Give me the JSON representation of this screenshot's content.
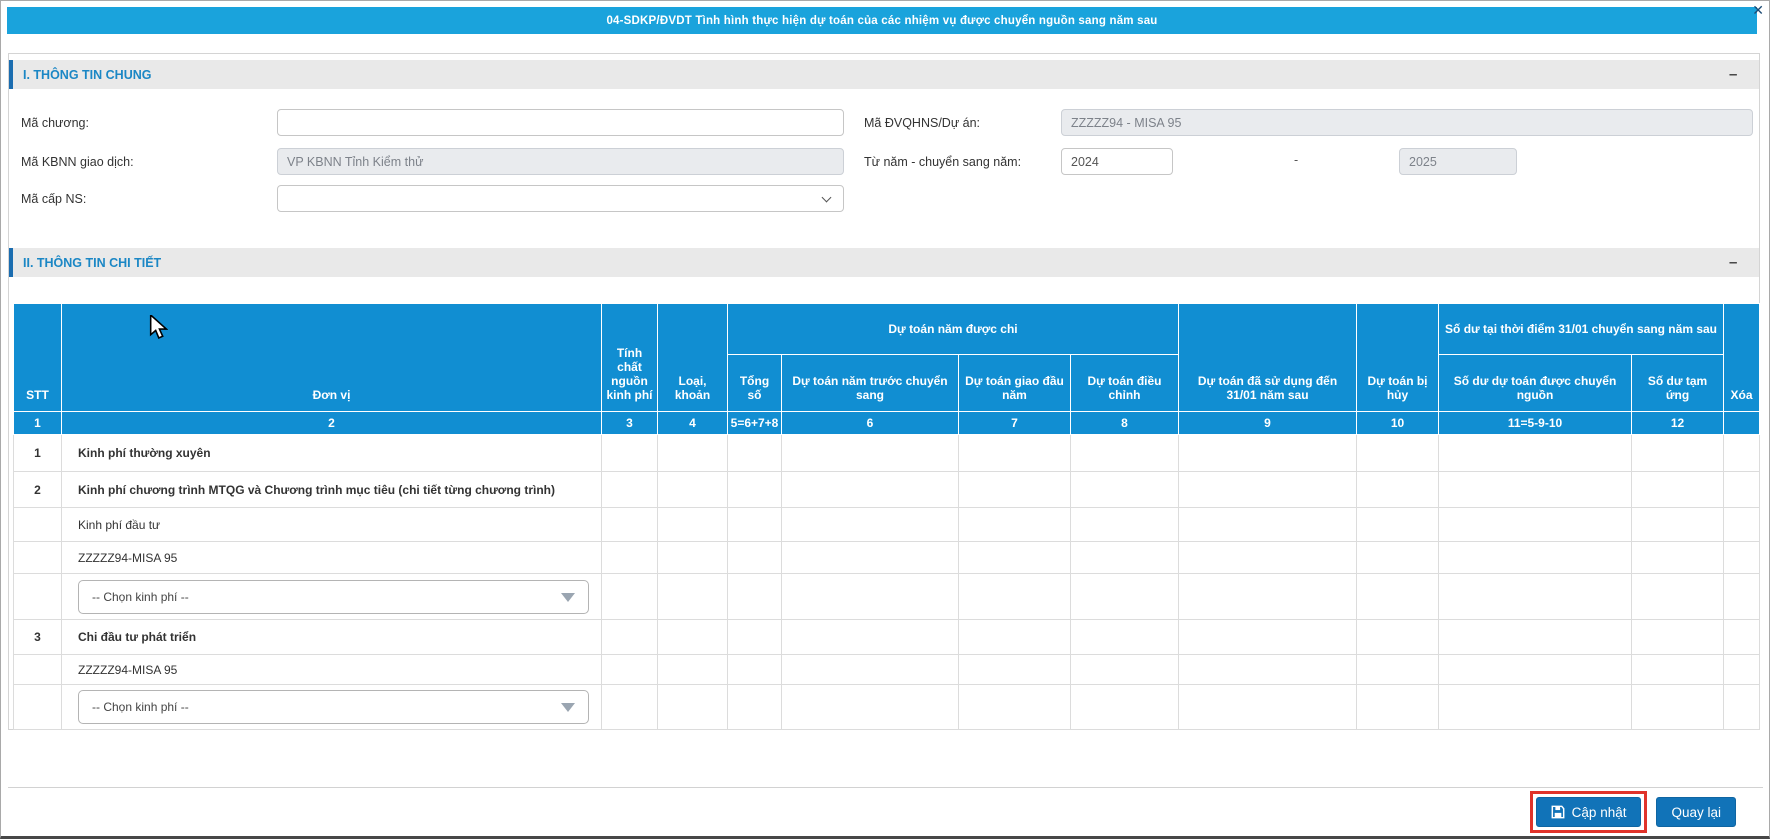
{
  "title_bar": {
    "title": "04-SDKP/ĐVDT Tình hình thực hiện dự toán của các nhiệm vụ được chuyển nguồn sang năm sau",
    "close_icon": "✕"
  },
  "section_general": {
    "heading": "I. THÔNG TIN CHUNG",
    "collapse_icon": "–"
  },
  "section_detail": {
    "heading": "II. THÔNG TIN CHI TIẾT",
    "collapse_icon": "–"
  },
  "form": {
    "ma_chuong_label": "Mã chương:",
    "ma_chuong_value": "",
    "ma_kbnn_label": "Mã KBNN giao dịch:",
    "ma_kbnn_value": "VP KBNN Tỉnh Kiểm thử",
    "ma_cap_ns_label": "Mã cấp NS:",
    "ma_cap_ns_value": "",
    "ma_dvqhns_label": "Mã ĐVQHNS/Dự án:",
    "ma_dvqhns_value": "ZZZZZ94 - MISA 95",
    "tu_nam_label": "Từ năm - chuyển sang năm:",
    "year_from": "2024",
    "year_separator": "-",
    "year_to": "2025"
  },
  "table": {
    "headers": {
      "stt": "STT",
      "don_vi": "Đơn vị",
      "tinh_chat": "Tính chất nguồn kinh phí",
      "loai_khoan": "Loại, khoản",
      "group_du_toan_nam_duoc_chi": "Dự toán năm được chi",
      "tong_so": "Tổng số",
      "nam_truoc_chuyen_sang": "Dự toán năm trước chuyển sang",
      "giao_dau_nam": "Dự toán giao đầu năm",
      "dieu_chinh": "Dự toán điều chỉnh",
      "da_su_dung": "Dự toán đã sử dụng đến 31/01 năm sau",
      "bi_huy": "Dự toán bị hủy",
      "group_so_du": "Số dư tại thời điểm 31/01 chuyển sang năm sau",
      "duoc_chuyen_nguon": "Số dư dự toán được chuyển nguồn",
      "tam_ung": "Số dư tạm ứng",
      "xoa": "Xóa"
    },
    "number_row": [
      "1",
      "2",
      "3",
      "4",
      "5=6+7+8",
      "6",
      "7",
      "8",
      "9",
      "10",
      "11=5-9-10",
      "12",
      ""
    ],
    "rows": [
      {
        "stt": "1",
        "don_vi": "Kinh phí thường xuyên"
      },
      {
        "stt": "2",
        "don_vi": "Kinh phí chương trình MTQG và Chương trình mục tiêu (chi tiết từng chương trình)"
      },
      {
        "stt": "",
        "don_vi": "Kinh phí đầu tư"
      },
      {
        "stt": "",
        "don_vi": "ZZZZZ94-MISA 95"
      },
      {
        "stt": "",
        "select_placeholder": "-- Chọn kinh phí --"
      },
      {
        "stt": "3",
        "don_vi": "Chi đầu tư phát triển"
      },
      {
        "stt": "",
        "don_vi": "ZZZZZ94-MISA 95"
      },
      {
        "stt": "",
        "select_placeholder": "-- Chọn kinh phí --"
      }
    ]
  },
  "footer": {
    "update_label": "Cập nhật",
    "back_label": "Quay lại"
  },
  "colors": {
    "titlebar_blue": "#1aa3dc",
    "table_header_blue": "#118ed2",
    "section_text_blue": "#1b87c5",
    "section_border_blue": "#1b6db0",
    "button_blue": "#1173b8",
    "highlight_red": "#e0332a",
    "disabled_input_bg": "#e9ebee"
  }
}
